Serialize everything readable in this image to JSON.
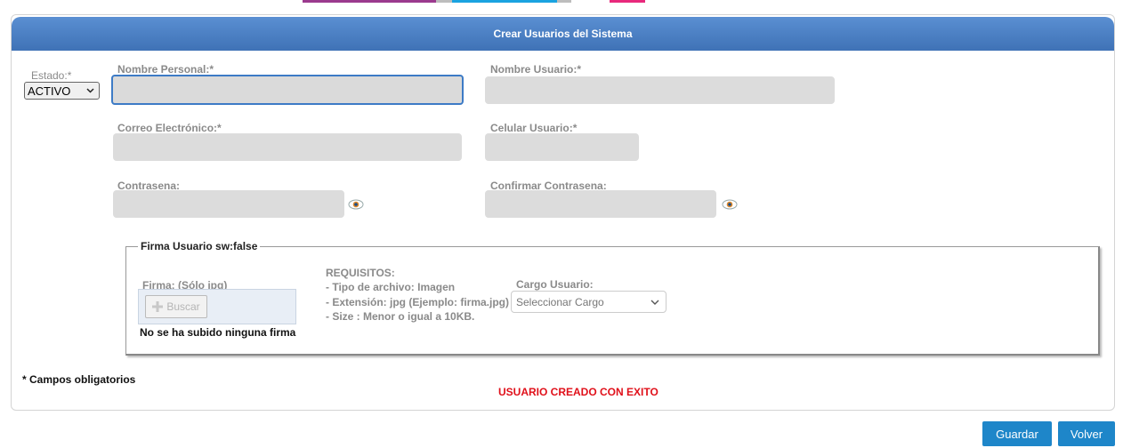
{
  "form": {
    "title": "Crear Usuarios del Sistema",
    "estado_label": "Estado:*",
    "estado_value": "ACTIVO",
    "nombre_personal_label": "Nombre Personal:*",
    "nombre_usuario_label": "Nombre Usuario:*",
    "correo_label": "Correo Electrónico:*",
    "celular_label": "Celular Usuario:*",
    "contrasena_label": "Contrasena:",
    "confirmar_contrasena_label": "Confirmar Contrasena:"
  },
  "firma": {
    "legend": "Firma Usuario sw:false",
    "firma_label": "Firma: (Sólo jpg)",
    "buscar_label": "Buscar",
    "no_firma": "No se ha subido ninguna firma",
    "requisitos_title": "REQUISITOS:",
    "requisitos_1": "- Tipo de archivo: Imagen",
    "requisitos_2": "- Extensión: jpg (Ejemplo: firma.jpg)",
    "requisitos_3": "- Size : Menor o igual a 10KB.",
    "cargo_label": "Cargo Usuario:",
    "cargo_value": "Seleccionar Cargo"
  },
  "footer": {
    "campos_obligatorios": "* Campos obligatorios",
    "status_message": "USUARIO CREADO CON EXITO",
    "guardar_label": "Guardar",
    "volver_label": "Volver"
  },
  "colors": {
    "header": "#4a7fc4",
    "status": "#e0101a",
    "button": "#1e86c9"
  },
  "icons": [
    "eye-icon",
    "chevron-down-icon",
    "plus-icon"
  ]
}
